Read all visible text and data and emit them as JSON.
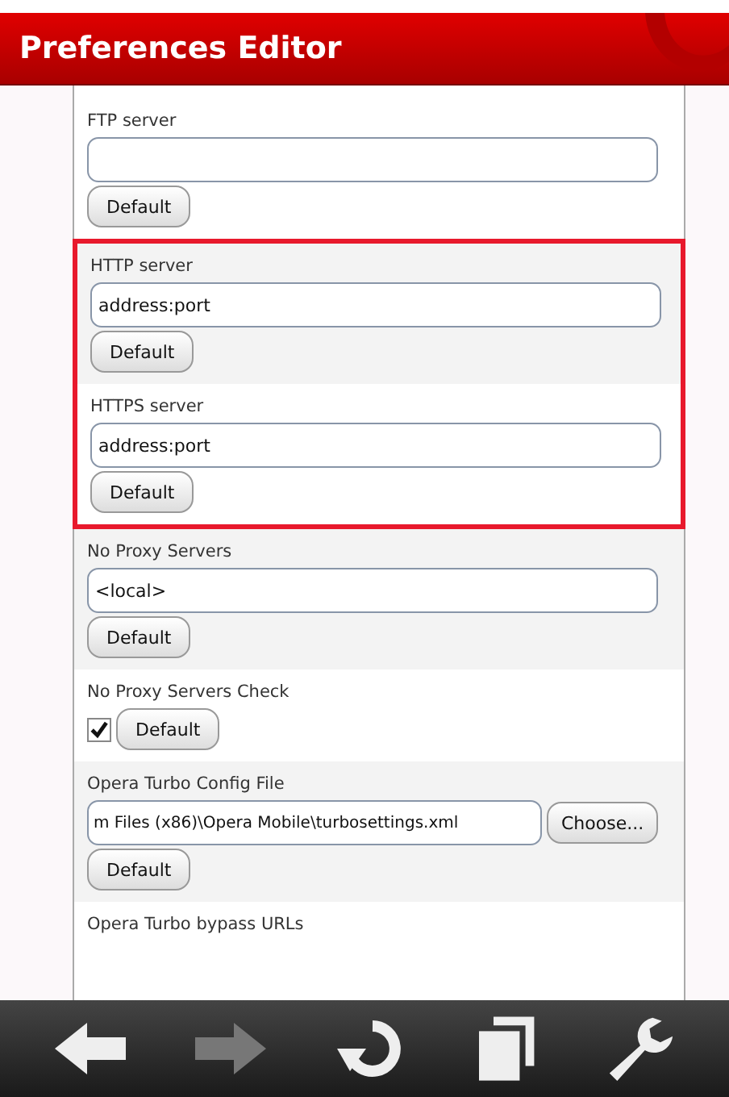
{
  "window": {
    "title": "Preferences Editor"
  },
  "sections": [
    {
      "highlighted": false,
      "items": [
        {
          "kind": "text",
          "label": "FTP server",
          "value": "",
          "default_button": "Default"
        }
      ]
    },
    {
      "highlighted": true,
      "items": [
        {
          "kind": "text",
          "label": "HTTP server",
          "value": "address:port",
          "default_button": "Default"
        },
        {
          "kind": "text",
          "label": "HTTPS server",
          "value": "address:port",
          "default_button": "Default"
        }
      ]
    },
    {
      "highlighted": false,
      "items": [
        {
          "kind": "text",
          "label": "No Proxy Servers",
          "value": "<local>",
          "default_button": "Default"
        },
        {
          "kind": "checkbox",
          "label": "No Proxy Servers Check",
          "checked": true,
          "default_button": "Default"
        },
        {
          "kind": "file",
          "label": "Opera Turbo Config File",
          "value": "m Files (x86)\\Opera Mobile\\turbosettings.xml",
          "choose_button": "Choose...",
          "default_button": "Default"
        },
        {
          "kind": "label",
          "label": "Opera Turbo bypass URLs"
        }
      ]
    }
  ],
  "toolbar": [
    {
      "kind": "back",
      "disabled": false
    },
    {
      "kind": "forward",
      "disabled": true
    },
    {
      "kind": "reload",
      "disabled": false
    },
    {
      "kind": "tabs",
      "disabled": false
    },
    {
      "kind": "settings",
      "disabled": false
    }
  ]
}
